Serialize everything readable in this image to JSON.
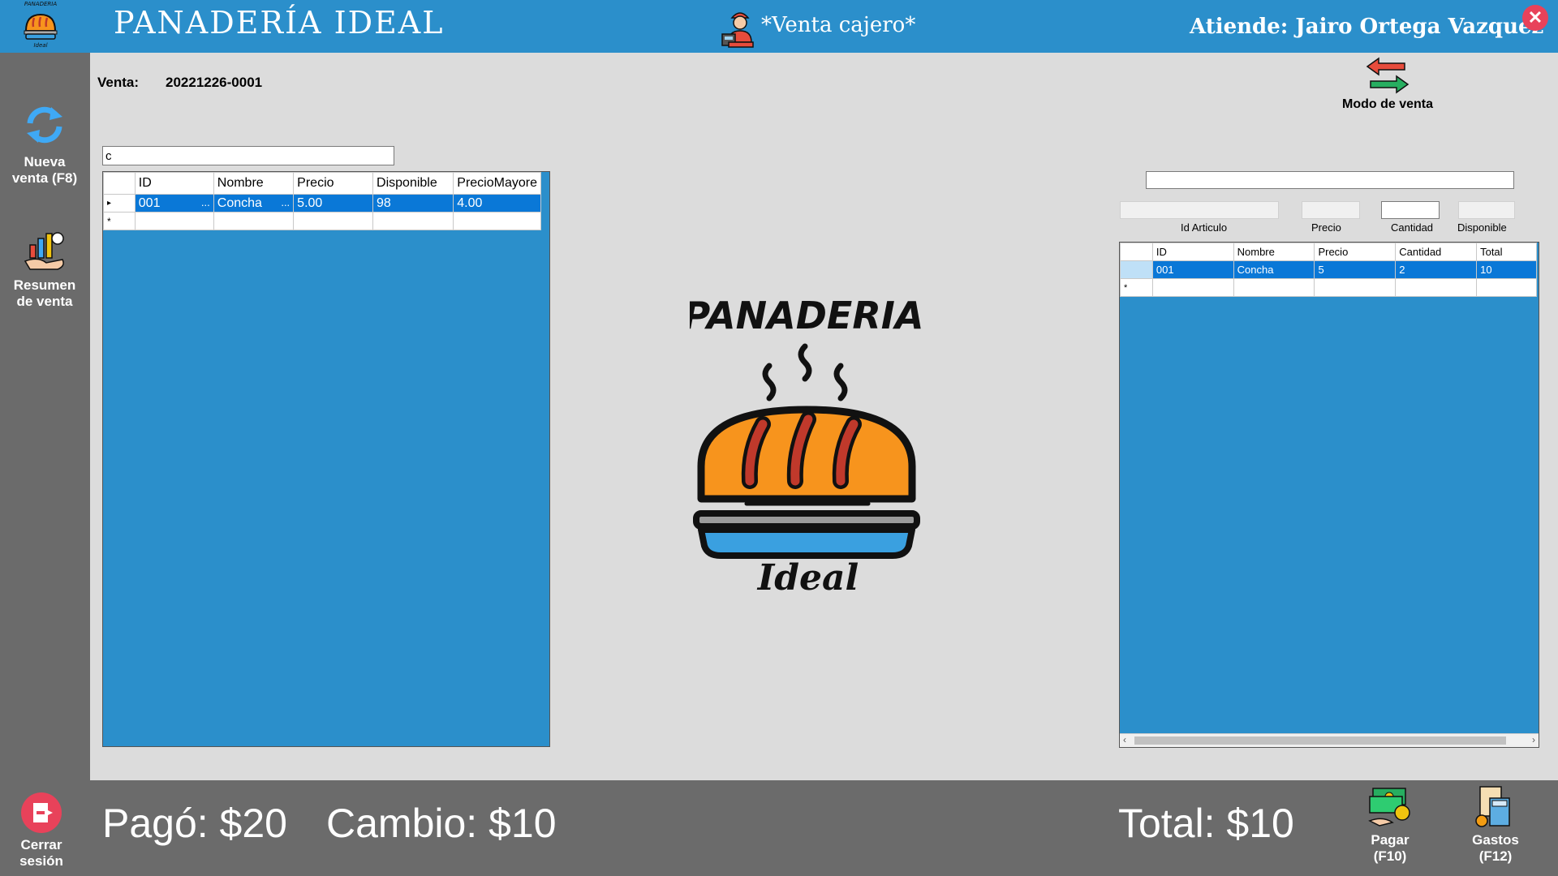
{
  "header": {
    "brand": "PANADERÍA IDEAL",
    "logo_text_top": "PANADERIA",
    "logo_text_bottom": "Ideal",
    "mode_title": "*Venta cajero*",
    "attends": "Atiende: Jairo Ortega Vazquez",
    "close_label": "✕"
  },
  "sidebar": {
    "new_sale": "Nueva venta (F8)",
    "summary": "Resumen de venta",
    "logout": "Cerrar sesión"
  },
  "sale": {
    "label": "Venta:",
    "number": "20221226-0001"
  },
  "mode_button": "Modo de venta",
  "search": {
    "value": "c"
  },
  "products_grid": {
    "columns": [
      "ID",
      "Nombre",
      "Precio",
      "Disponible",
      "PrecioMayore"
    ],
    "rows": [
      [
        "001",
        "Concha",
        "5.00",
        "98",
        "4.00"
      ]
    ],
    "ellipsis": "...",
    "row_marker": "▸",
    "new_marker": "*"
  },
  "detail": {
    "barcode_value": "",
    "id_label": "Id Articulo",
    "price_label": "Precio",
    "qty_label": "Cantidad",
    "available_label": "Disponible"
  },
  "cart_grid": {
    "columns": [
      "ID",
      "Nombre",
      "Precio",
      "Cantidad",
      "Total"
    ],
    "rows": [
      [
        "001",
        "Concha",
        "5",
        "2",
        "10"
      ]
    ],
    "new_marker": "*"
  },
  "center_logo": {
    "top": "PANADERIA",
    "bottom": "Ideal"
  },
  "footer": {
    "paid": "Pagó: $20",
    "change": "Cambio: $10",
    "total": "Total: $10",
    "pay_label": "Pagar (F10)",
    "expenses_label": "Gastos (F12)"
  },
  "colors": {
    "primary": "#2b8fcb",
    "sidebar": "#6b6b6b",
    "selection": "#0a78d7",
    "close": "#e8425a"
  }
}
